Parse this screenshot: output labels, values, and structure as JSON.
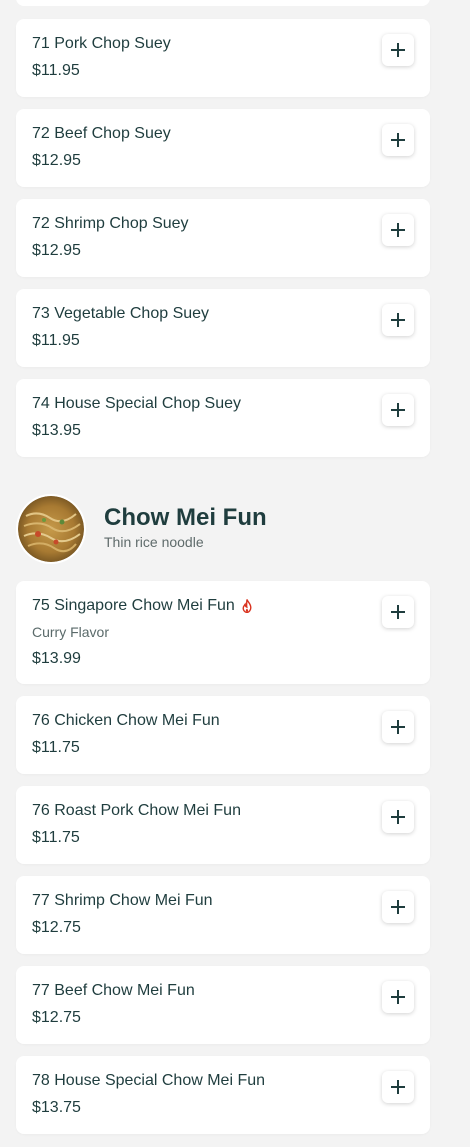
{
  "app": {
    "accent_color": "#1f3d3e",
    "background_color": "#f3f3f3"
  },
  "menu_sections": [
    {
      "items": [
        {
          "name": "71 Pork Chop Suey",
          "price": "$11.95"
        },
        {
          "name": "72 Beef Chop Suey",
          "price": "$12.95"
        },
        {
          "name": "72 Shrimp Chop Suey",
          "price": "$12.95"
        },
        {
          "name": "73 Vegetable Chop Suey",
          "price": "$11.95"
        },
        {
          "name": "74 House Special Chop Suey",
          "price": "$13.95"
        }
      ]
    },
    {
      "title": "Chow Mei Fun",
      "subtitle": "Thin rice noodle",
      "image_icon": "noodle-dish-image",
      "items": [
        {
          "name": "75 Singapore Chow Mei Fun",
          "description": "Curry Flavor",
          "price": "$13.99",
          "spicy_icon": "flame-icon",
          "spicy_color": "#d9321e"
        },
        {
          "name": "76 Chicken Chow Mei Fun",
          "price": "$11.75"
        },
        {
          "name": "76 Roast Pork Chow Mei Fun",
          "price": "$11.75"
        },
        {
          "name": "77 Shrimp Chow Mei Fun",
          "price": "$12.75"
        },
        {
          "name": "77 Beef Chow Mei Fun",
          "price": "$12.75"
        },
        {
          "name": "78 House Special Chow Mei Fun",
          "price": "$13.75"
        }
      ]
    }
  ],
  "add_button_icon": "plus-icon"
}
